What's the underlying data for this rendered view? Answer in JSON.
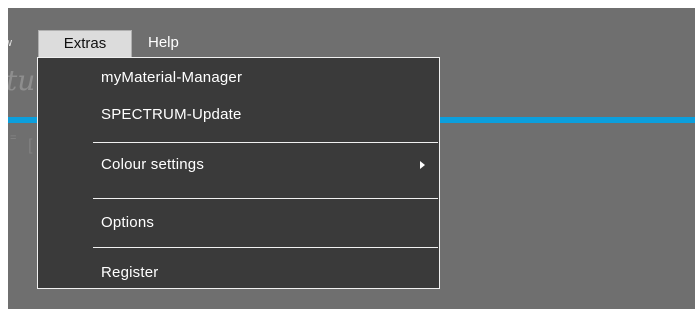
{
  "menubar": {
    "view_label": "w",
    "extras_label": "Extras",
    "help_label": "Help"
  },
  "app": {
    "title_fragment": "tu"
  },
  "extras_menu": {
    "items": [
      {
        "label": "myMaterial-Manager"
      },
      {
        "label": "SPECTRUM-Update"
      },
      {
        "label": "Colour settings",
        "has_submenu": true
      },
      {
        "label": "Options"
      },
      {
        "label": "Register"
      }
    ]
  },
  "colors": {
    "background": "#6f6f6f",
    "menu_background": "#3a3a3a",
    "accent": "#0c9fdc",
    "active_menubar_item": "#dcdcdc"
  }
}
